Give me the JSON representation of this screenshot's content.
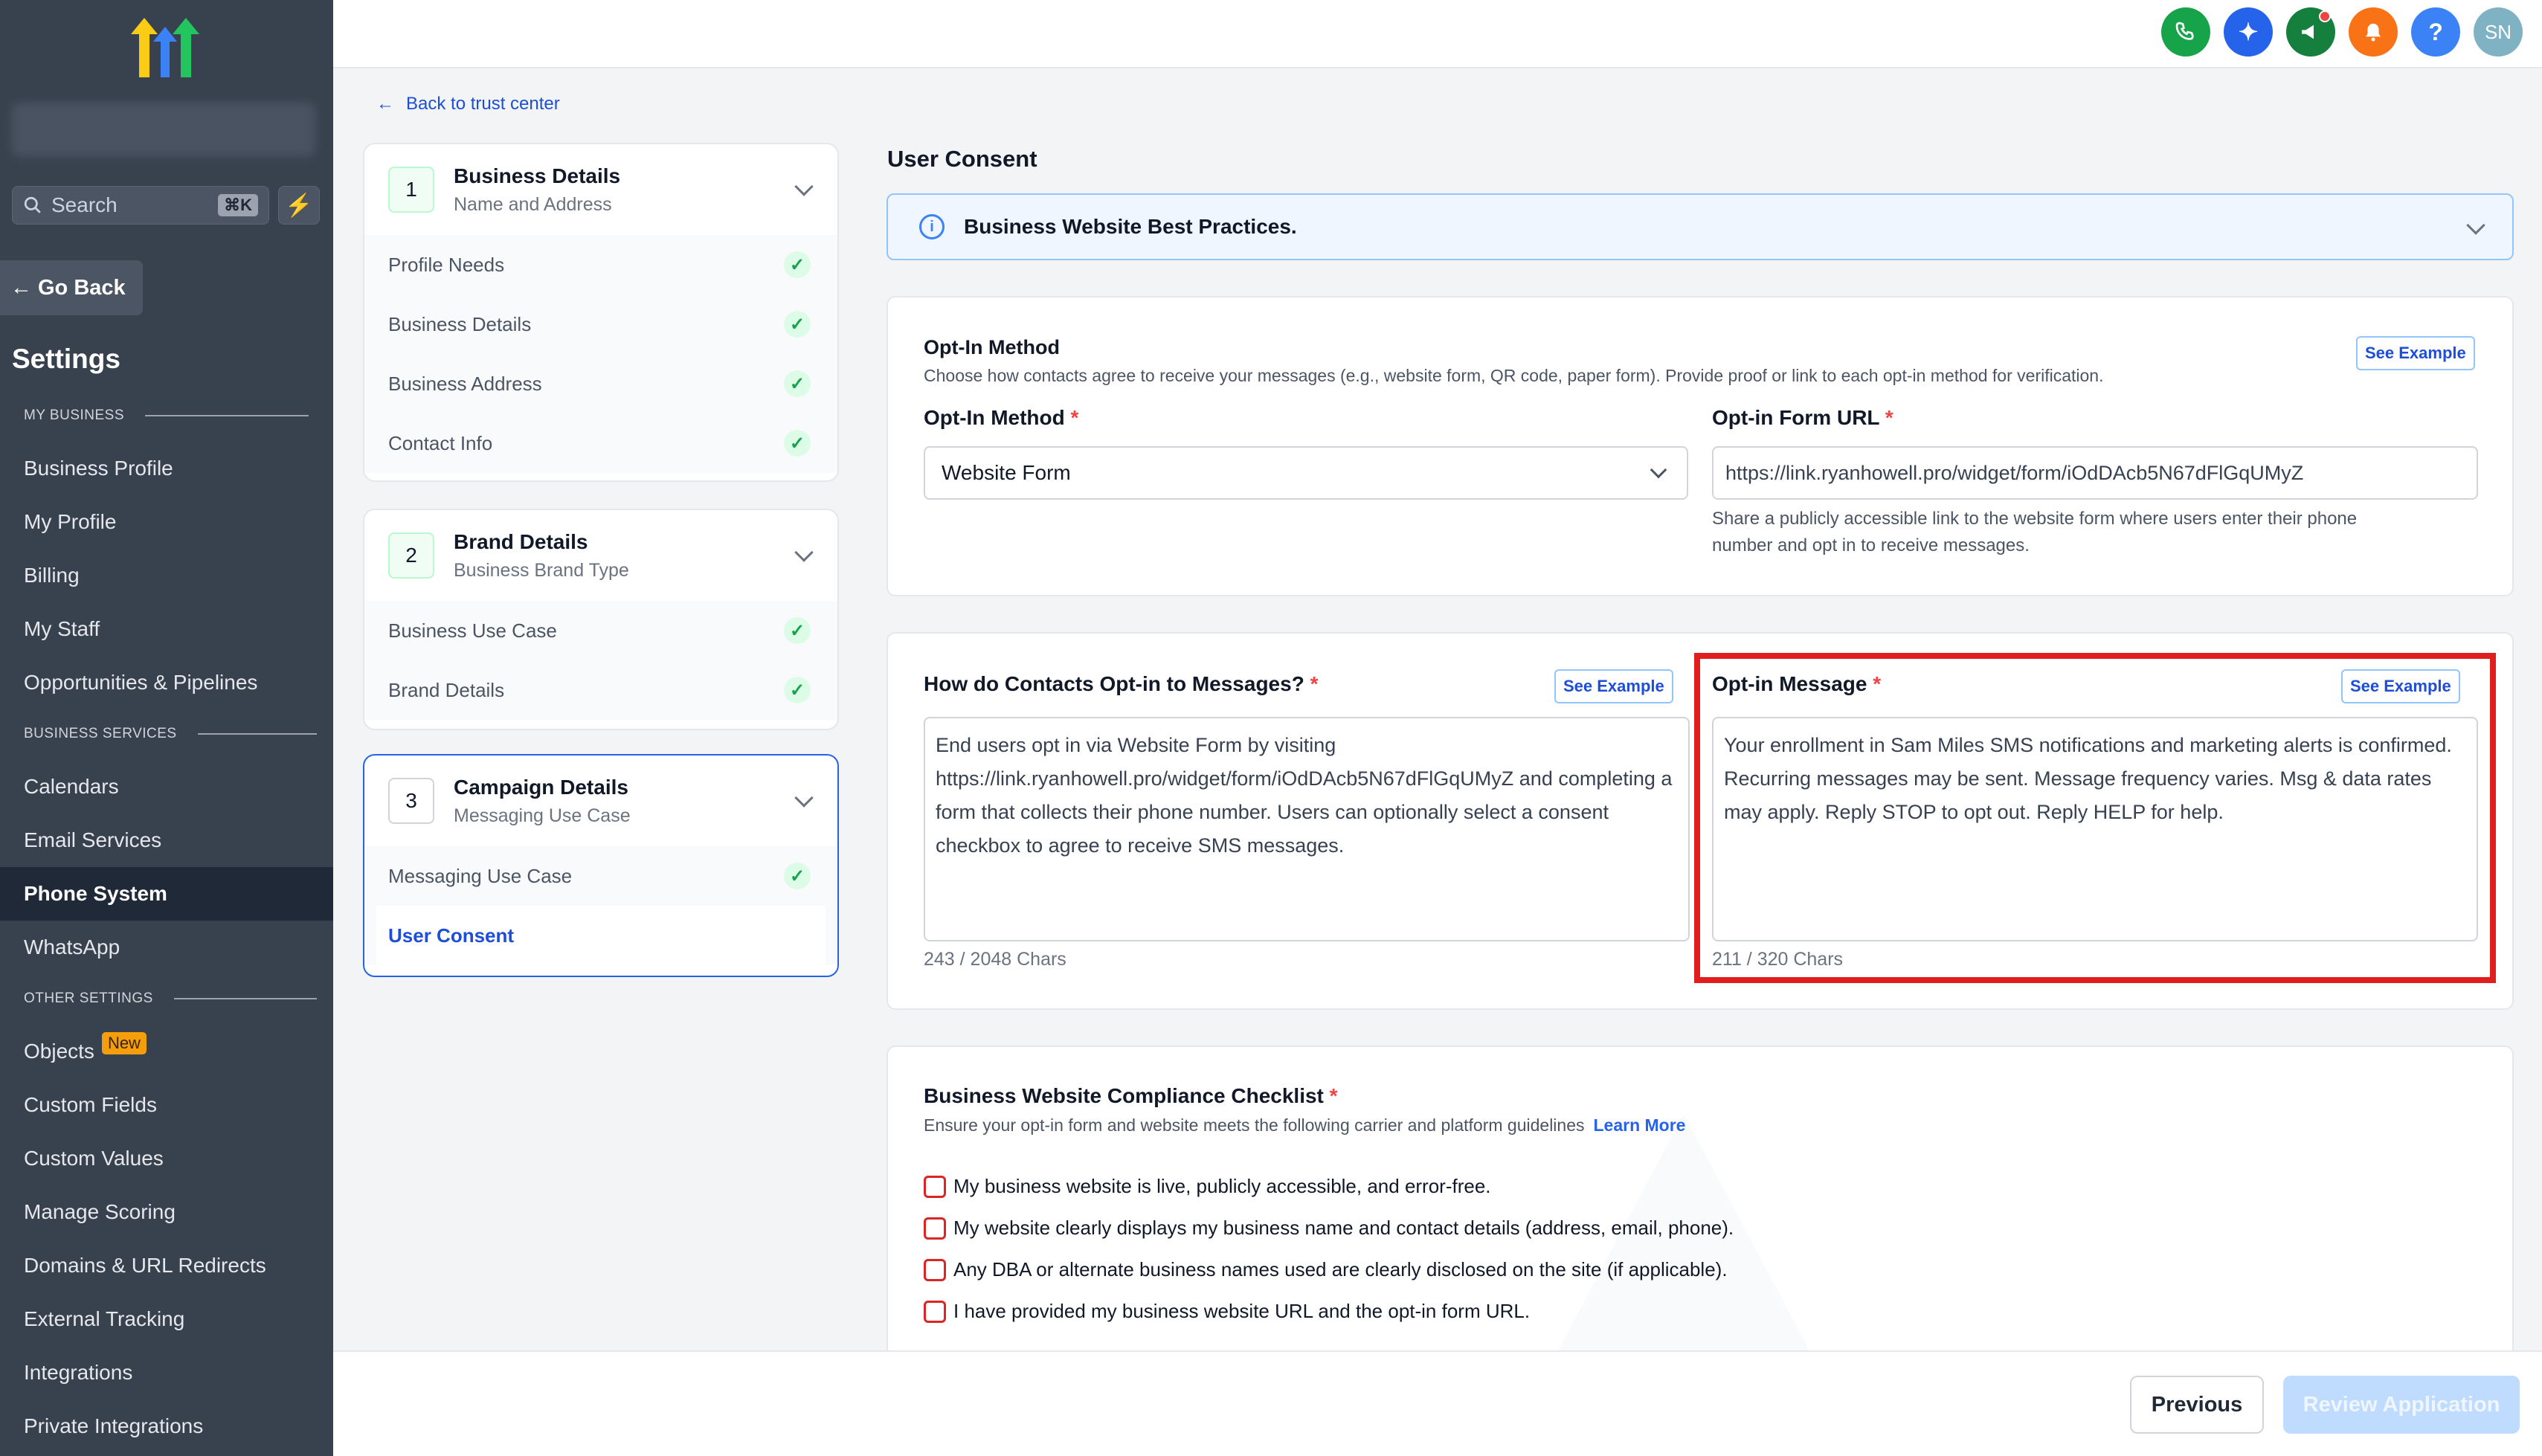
{
  "sidebar": {
    "search_placeholder": "Search",
    "search_shortcut": "⌘K",
    "go_back": "Go Back",
    "settings_title": "Settings",
    "sections": {
      "my_business": "MY BUSINESS",
      "business_services": "BUSINESS SERVICES",
      "other_settings": "OTHER SETTINGS"
    },
    "items": [
      {
        "label": "Business Profile"
      },
      {
        "label": "My Profile"
      },
      {
        "label": "Billing"
      },
      {
        "label": "My Staff"
      },
      {
        "label": "Opportunities & Pipelines"
      },
      {
        "label": "Calendars"
      },
      {
        "label": "Email Services"
      },
      {
        "label": "Phone System",
        "active": true
      },
      {
        "label": "WhatsApp"
      },
      {
        "label": "Objects",
        "badge": "New"
      },
      {
        "label": "Custom Fields"
      },
      {
        "label": "Custom Values"
      },
      {
        "label": "Manage Scoring"
      },
      {
        "label": "Domains & URL Redirects"
      },
      {
        "label": "External Tracking"
      },
      {
        "label": "Integrations"
      },
      {
        "label": "Private Integrations"
      }
    ]
  },
  "topbar": {
    "avatar_initials": "SN",
    "help_label": "?",
    "colors": {
      "phone": "#16a34a",
      "ai": "#2563eb",
      "announce": "#15803d",
      "bell": "#f97316",
      "help": "#3b82f6",
      "avatar": "#7fb3c4"
    }
  },
  "stepper": {
    "back_link": "Back to trust center",
    "steps": [
      {
        "num": "1",
        "title": "Business Details",
        "subtitle": "Name and Address",
        "items": [
          "Profile Needs",
          "Business Details",
          "Business Address",
          "Contact Info"
        ]
      },
      {
        "num": "2",
        "title": "Brand Details",
        "subtitle": "Business Brand Type",
        "items": [
          "Business Use Case",
          "Brand Details"
        ]
      },
      {
        "num": "3",
        "title": "Campaign Details",
        "subtitle": "Messaging Use Case",
        "items": [
          "Messaging Use Case",
          "User Consent"
        ]
      }
    ]
  },
  "main": {
    "heading": "User Consent",
    "info_bar": "Business Website Best Practices.",
    "optin_card": {
      "title": "Opt-In Method",
      "description": "Choose how contacts agree to receive your messages (e.g., website form, QR code, paper form). Provide proof or link to each opt-in method for verification.",
      "see_example": "See Example",
      "method_label": "Opt-In Method",
      "method_value": "Website Form",
      "url_label": "Opt-in Form URL",
      "url_value": "https://link.ryanhowell.pro/widget/form/iOdDAcb5N67dFlGqUMyZ",
      "url_help_1": "Share a publicly accessible link to the website form where users enter their phone",
      "url_help_2": "number and opt in to receive messages."
    },
    "message_card": {
      "how_label": "How do Contacts Opt-in to Messages?",
      "how_see_example": "See Example",
      "how_text": "End users opt in via Website Form by visiting https://link.ryanhowell.pro/widget/form/iOdDAcb5N67dFlGqUMyZ and completing a form that collects their phone number. Users can optionally select a consent checkbox to agree to receive SMS messages.",
      "how_chars": "243 / 2048 Chars",
      "msg_label": "Opt-in Message",
      "msg_see_example": "See Example",
      "msg_text": "Your enrollment in Sam Miles SMS notifications and marketing alerts is confirmed. Recurring messages may be sent. Message frequency varies. Msg & data rates may apply. Reply STOP to opt out. Reply HELP for help.",
      "msg_chars": "211 / 320 Chars"
    },
    "checklist": {
      "title": "Business Website Compliance Checklist",
      "description": "Ensure your opt-in form and website meets the following carrier and platform guidelines",
      "learn_more": "Learn More",
      "items": [
        "My business website is live, publicly accessible, and error-free.",
        "My website clearly displays my business name and contact details (address, email, phone).",
        "Any DBA or alternate business names used are clearly disclosed on the site (if applicable).",
        "I have provided my business website URL and the opt-in form URL."
      ]
    }
  },
  "footer": {
    "previous": "Previous",
    "review": "Review Application"
  }
}
